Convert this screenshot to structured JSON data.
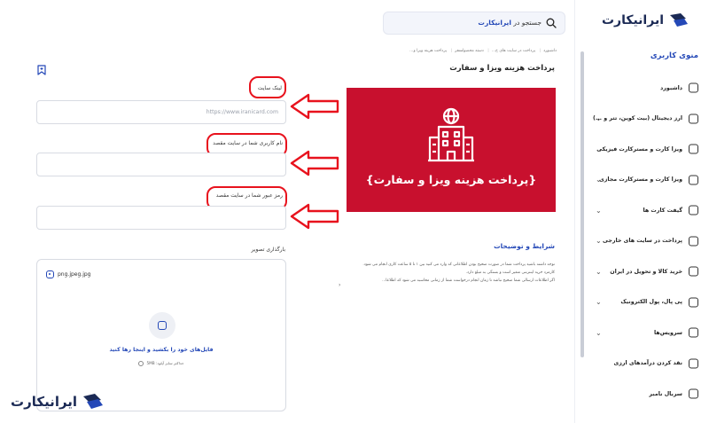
{
  "brand": {
    "name": "ایرانیکارت"
  },
  "search": {
    "prefix": "جستجو در",
    "brand": "ایرانیکارت"
  },
  "breadcrumb": [
    "داشبورد",
    "پرداخت در سایت های خ...",
    "دسته محصولسفر",
    "پرداخت هزینه ویزا و..."
  ],
  "page": {
    "title": "پرداخت هزینه ویزا و سفارت"
  },
  "banner": {
    "text": "{پرداخت هزینه ویزا و سفارت}",
    "bg": "#c8102e"
  },
  "form": {
    "site_link": {
      "label": "لینک سایت",
      "placeholder": "https://www.iranicard.com"
    },
    "username": {
      "label": "نام کاربری شما در سایت مقصد",
      "value": ""
    },
    "password": {
      "label": "رمز عبور شما در سایت مقصد",
      "value": ""
    }
  },
  "upload": {
    "label": "بارگذاری تصویر",
    "file_name": "png.jpeg.jpg",
    "drop_text": "فایل‌های خود را بکشید و اینجا رها کنید",
    "hint": "حداکثر سایز آپلود: 5MB"
  },
  "terms": {
    "title": "شرایط و توضیحات",
    "lines": [
      "توجه داشته باشید پرداخت شما در صورت صحیح بودن اطلاعاتی که وارد می کنید بین ۱ تا ۵ ساعت کاری انجام می شود.",
      "کارمزد خرید اینترنتی متغیر است و بستگی به مبلغ دارد.",
      "اگر اطلاعات ارسالی شما صحیح نباشد تا زمان انجام درخواست شما از زمانی محاسبه می شود که اطلاعا..."
    ],
    "more": "›"
  },
  "sidebar": {
    "title": "منوی کاربری",
    "items": [
      {
        "label": "داشبورد",
        "chevron": false
      },
      {
        "label": "ارز دیجیتال (بیت کوین، تتر و ...)",
        "chevron": true
      },
      {
        "label": "ویزا کارت و مسترکارت فیزیکی",
        "chevron": true
      },
      {
        "label": "ویزا کارت و مسترکارت مجازی",
        "chevron": true
      },
      {
        "label": "گیفت کارت ها",
        "chevron": true
      },
      {
        "label": "پرداخت در سایت های خارجی",
        "chevron": true
      },
      {
        "label": "خرید کالا و تحویل در ایران",
        "chevron": true
      },
      {
        "label": "پی پال، پول الکترونیک",
        "chevron": true
      },
      {
        "label": "سرویس‌ها",
        "chevron": true
      },
      {
        "label": "نقد کردن درآمدهای ارزی",
        "chevron": false
      },
      {
        "label": "سربال نامبر",
        "chevron": false
      }
    ]
  },
  "colors": {
    "accent": "#2448b7",
    "annotation": "#e8121d",
    "banner": "#c8102e"
  }
}
